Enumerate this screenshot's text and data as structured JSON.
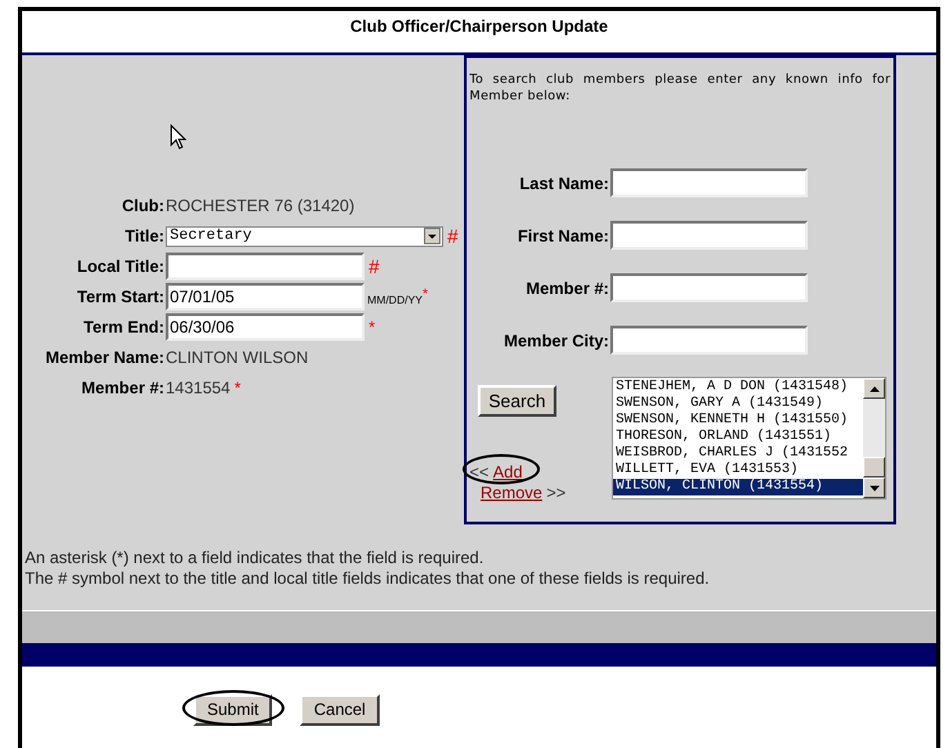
{
  "header": {
    "title": "Club Officer/Chairperson Update"
  },
  "officer_form": {
    "fields": [
      {
        "kind": "text",
        "label": "Club:",
        "value": "ROCHESTER 76 (31420)"
      },
      {
        "kind": "select",
        "label": "Title:",
        "value": "Secretary",
        "marker": "#"
      },
      {
        "kind": "input",
        "label": "Local Title:",
        "marker": "#"
      },
      {
        "kind": "input",
        "label": "Term Start:",
        "value": "07/01/05",
        "hint": "MM/DD/YY",
        "marker": "*"
      },
      {
        "kind": "input",
        "label": "Term End:",
        "value": "06/30/06",
        "marker": "*"
      },
      {
        "kind": "text",
        "label": "Member Name:",
        "value": "CLINTON WILSON"
      },
      {
        "kind": "text",
        "label": "Member #:",
        "value": "1431554",
        "marker": "*"
      }
    ]
  },
  "member_search": {
    "instructions": "To search club members please enter any known info for Member below:",
    "fields": [
      {
        "label": "Last Name:"
      },
      {
        "label": "First Name:"
      },
      {
        "label": "Member #:"
      },
      {
        "label": "Member City:"
      }
    ],
    "search_button": "Search",
    "results": [
      {
        "label": "STENEJHEM, A D DON (1431548)",
        "selected": false
      },
      {
        "label": "SWENSON, GARY A (1431549)",
        "selected": false
      },
      {
        "label": "SWENSON, KENNETH H (1431550)",
        "selected": false
      },
      {
        "label": "THORESON, ORLAND (1431551)",
        "selected": false
      },
      {
        "label": "WEISBROD, CHARLES J (1431552",
        "selected": false
      },
      {
        "label": "WILLETT, EVA (1431553)",
        "selected": false
      },
      {
        "label": "WILSON, CLINTON (1431554)",
        "selected": true
      }
    ],
    "add": {
      "prefix": "<<",
      "label": "Add",
      "circled": true
    },
    "remove": {
      "label": "Remove",
      "suffix": ">>",
      "circled": false
    }
  },
  "notes": [
    "An asterisk (*) next to a field indicates that the field is required.",
    "The # symbol next to the title and local title fields indicates that one of these fields is required."
  ],
  "buttons": [
    {
      "label": "Submit",
      "circled": true
    },
    {
      "label": "Cancel",
      "circled": false
    }
  ]
}
